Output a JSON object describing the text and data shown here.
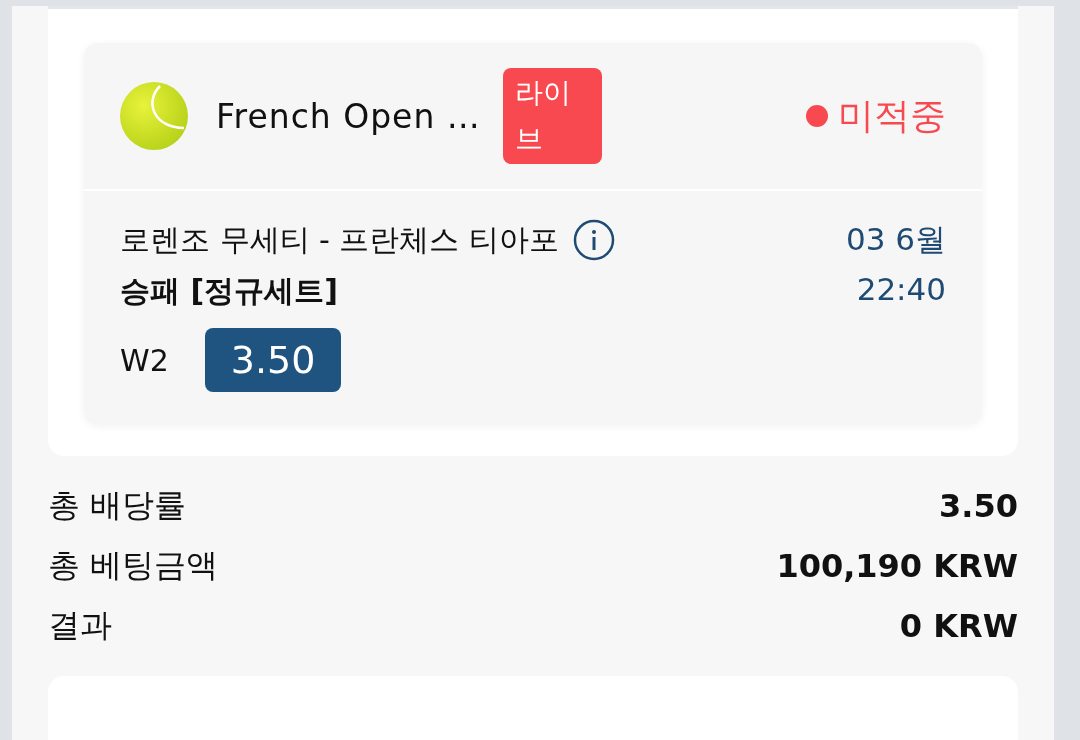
{
  "bet_card": {
    "match": {
      "tournament": "French Open …",
      "badge": "라이브",
      "status": "미적중",
      "teams": "로렌조 무세티 - 프란체스 티아포",
      "market": "승패 [정규세트]",
      "date": "03 6월",
      "time": "22:40",
      "pick": "W2",
      "odds": "3.50"
    }
  },
  "summary": [
    {
      "label": "총 배당률",
      "value": "3.50"
    },
    {
      "label": "총 베팅금액",
      "value": "100,190 KRW"
    },
    {
      "label": "결과",
      "value": "0 KRW"
    }
  ]
}
